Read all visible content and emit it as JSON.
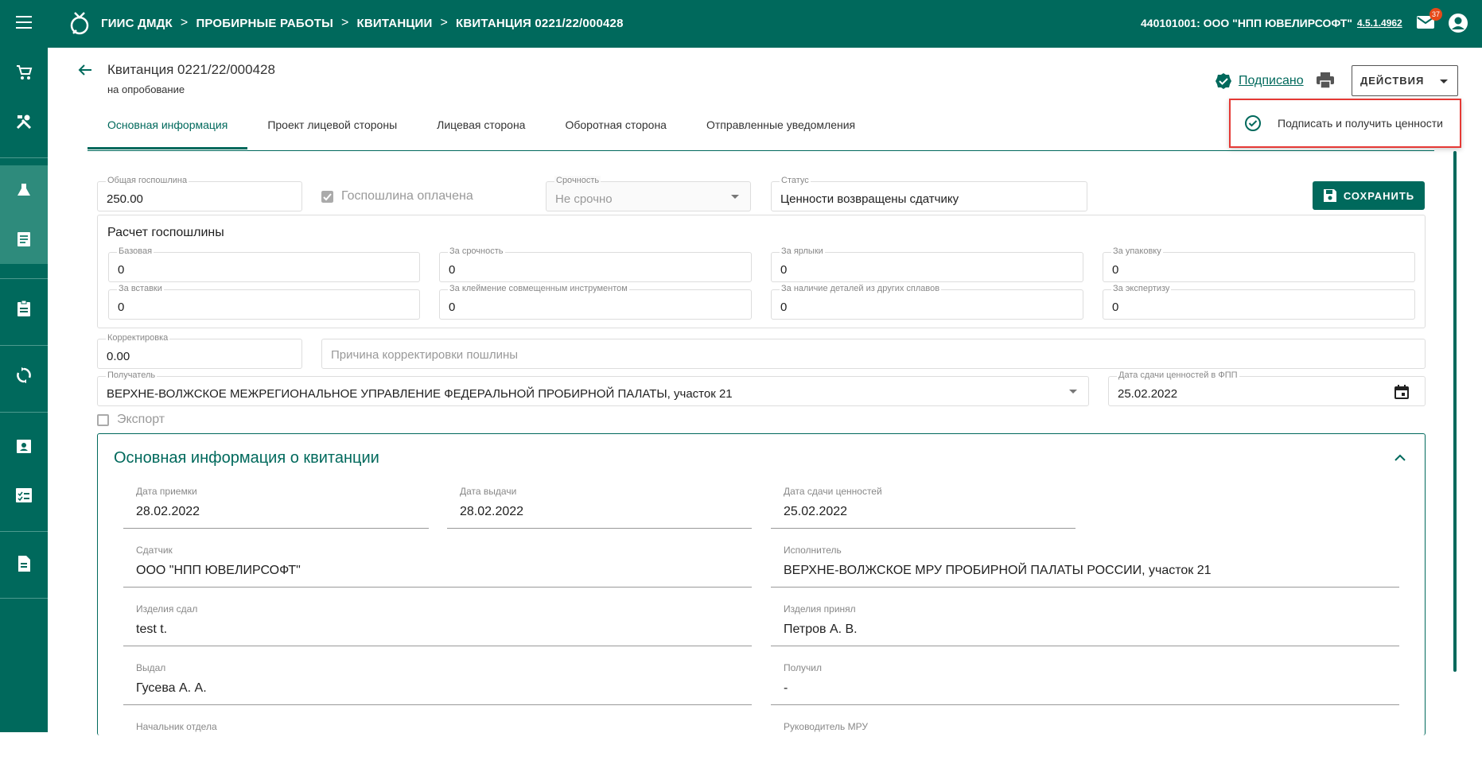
{
  "header": {
    "breadcrumbs": [
      "ГИИС ДМДК",
      "ПРОБИРНЫЕ РАБОТЫ",
      "КВИТАНЦИИ",
      "КВИТАНЦИЯ 0221/22/000428"
    ],
    "sep": ">",
    "org": "440101001: ООО \"НПП ЮВЕЛИРСОФТ\"",
    "version": "4.5.1.4962",
    "mail_count": "37"
  },
  "page": {
    "title": "Квитанция 0221/22/000428",
    "subtitle": "на опробование",
    "signed_label": "Подписано",
    "actions_label": "ДЕЙСТВИЯ",
    "menu_item": "Подписать и получить ценности"
  },
  "tabs": [
    "Основная информация",
    "Проект лицевой стороны",
    "Лицевая сторона",
    "Оборотная сторона",
    "Отправленные уведомления"
  ],
  "form": {
    "total_fee_label": "Общая госпошлина",
    "total_fee": "250.00",
    "fee_paid_label": "Госпошлина оплачена",
    "urgency_label": "Срочность",
    "urgency": "Не срочно",
    "status_label": "Статус",
    "status": "Ценности возвращены сдатчику",
    "save_label": "СОХРАНИТЬ",
    "calc_title": "Расчет госпошлины",
    "calc": [
      {
        "label": "Базовая",
        "value": "0"
      },
      {
        "label": "За срочность",
        "value": "0"
      },
      {
        "label": "За ярлыки",
        "value": "0"
      },
      {
        "label": "За упаковку",
        "value": "0"
      },
      {
        "label": "За вставки",
        "value": "0"
      },
      {
        "label": "За клеймение совмещенным инструментом",
        "value": "0"
      },
      {
        "label": "За наличие деталей из других сплавов",
        "value": "0"
      },
      {
        "label": "За экспертизу",
        "value": "0"
      }
    ],
    "correction_label": "Корректировка",
    "correction": "0.00",
    "reason_placeholder": "Причина корректировки пошлины",
    "recipient_label": "Получатель",
    "recipient": "ВЕРХНЕ-ВОЛЖСКОЕ МЕЖРЕГИОНАЛЬНОЕ УПРАВЛЕНИЕ ФЕДЕРАЛЬНОЙ ПРОБИРНОЙ ПАЛАТЫ, участок 21",
    "handover_label": "Дата сдачи ценностей в ФПП",
    "handover": "25.02.2022",
    "export_label": "Экспорт"
  },
  "panel": {
    "title": "Основная информация о квитанции",
    "fields": [
      {
        "label": "Дата приемки",
        "value": "28.02.2022"
      },
      {
        "label": "Дата выдачи",
        "value": "28.02.2022"
      },
      {
        "label": "Дата сдачи ценностей",
        "value": "25.02.2022"
      },
      {
        "label": "Сдатчик",
        "value": "ООО \"НПП ЮВЕЛИРСОФТ\""
      },
      {
        "label": "Исполнитель",
        "value": "ВЕРХНЕ-ВОЛЖСКОЕ МРУ ПРОБИРНОЙ ПАЛАТЫ РОССИИ, участок 21"
      },
      {
        "label": "Изделия сдал",
        "value": "test t."
      },
      {
        "label": "Изделия принял",
        "value": "Петров А. В."
      },
      {
        "label": "Выдал",
        "value": "Гусева А. А."
      },
      {
        "label": "Получил",
        "value": "-"
      },
      {
        "label": "Начальник отдела",
        "value": ""
      },
      {
        "label": "Руководитель МРУ",
        "value": ""
      }
    ]
  },
  "colors": {
    "primary": "#00695c",
    "accent": "#e53935",
    "badge": "#e64a19"
  }
}
